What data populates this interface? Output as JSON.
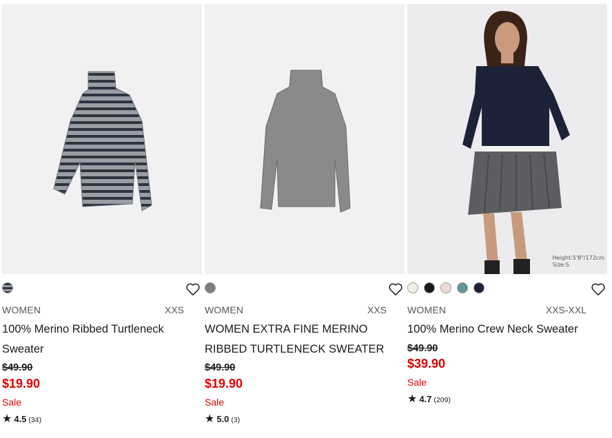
{
  "products": [
    {
      "gender": "WOMEN",
      "sizes": "XXS",
      "title": "100% Merino Ribbed Turtleneck Sweater",
      "old_price": "$49.90",
      "price": "$19.90",
      "sale": "Sale",
      "rating": "4.5",
      "review_count": "(34)",
      "swatches": [
        "#55606e"
      ]
    },
    {
      "gender": "WOMEN",
      "sizes": "XXS",
      "title": "WOMEN EXTRA FINE MERINO RIBBED TURTLENECK SWEATER",
      "old_price": "$49.90",
      "price": "$19.90",
      "sale": "Sale",
      "rating": "5.0",
      "review_count": "(3)",
      "swatches": [
        "#7d7d7d"
      ]
    },
    {
      "gender": "WOMEN",
      "sizes": "XXS-XXL",
      "title": "100% Merino Crew Neck Sweater",
      "old_price": "$49.90",
      "price": "$39.90",
      "sale": "Sale",
      "rating": "4.7",
      "review_count": "(209)",
      "swatches": [
        "#f4efe6",
        "#1a1a1a",
        "#f3d9d6",
        "#5f9596",
        "#1c2237"
      ],
      "photo_caption_height": "Height:5'8\"/172cm",
      "photo_caption_size": "Size:S"
    }
  ],
  "icons": {
    "favorite": "heart-outline-icon",
    "rating": "star-icon"
  },
  "colors": {
    "sale": "#e00000",
    "text": "#1b1b1b",
    "image_bg": "#f1f1f2"
  }
}
